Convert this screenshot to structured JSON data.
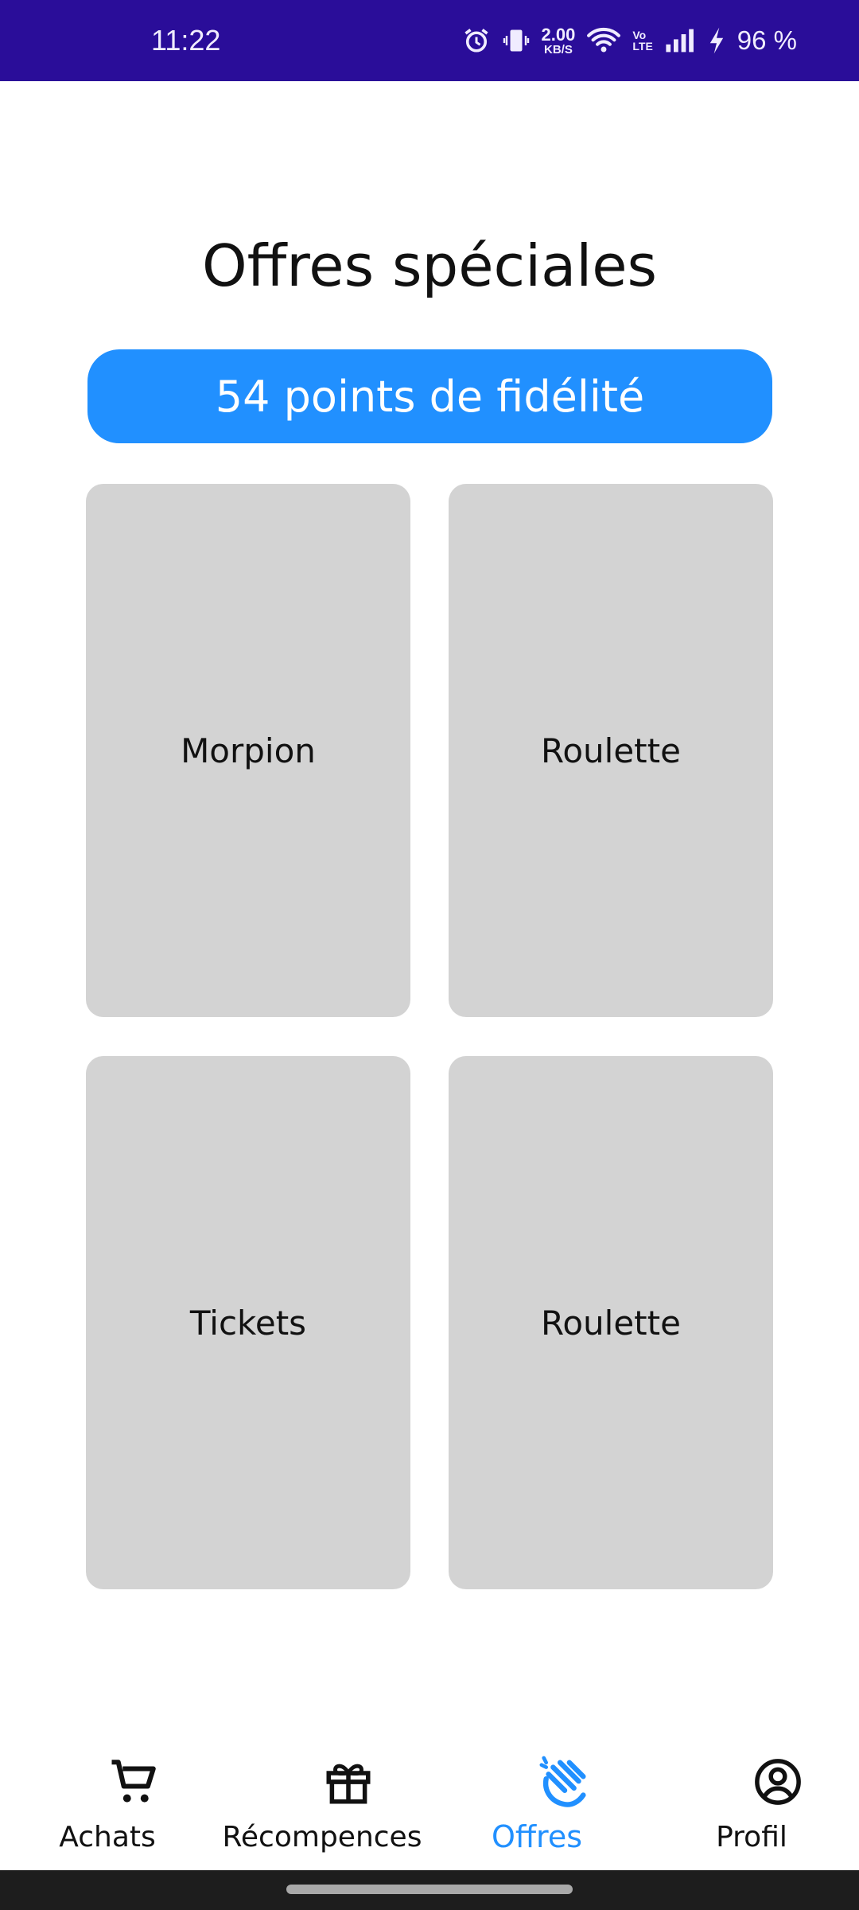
{
  "status_bar": {
    "time": "11:22",
    "net_speed_value": "2.00",
    "net_speed_unit": "KB/S",
    "volte_top": "Vo",
    "volte_bottom": "LTE",
    "battery_percent": "96 %",
    "icons": [
      "alarm-icon",
      "vibrate-icon",
      "wifi-icon",
      "volte-icon",
      "signal-icon",
      "charging-icon"
    ]
  },
  "page": {
    "title": "Offres spéciales",
    "points_label": "54 points de fidélité",
    "accent_color": "#2190ff"
  },
  "offers": [
    {
      "label": "Morpion"
    },
    {
      "label": "Roulette"
    },
    {
      "label": "Tickets"
    },
    {
      "label": "Roulette"
    }
  ],
  "bottom_nav": {
    "items": [
      {
        "label": "Achats",
        "icon": "cart-icon",
        "active": false
      },
      {
        "label": "Récompences",
        "icon": "gift-icon",
        "active": false
      },
      {
        "label": "Offres",
        "icon": "offers-hand-icon",
        "active": true
      },
      {
        "label": "Profil",
        "icon": "profile-icon",
        "active": false
      }
    ]
  }
}
